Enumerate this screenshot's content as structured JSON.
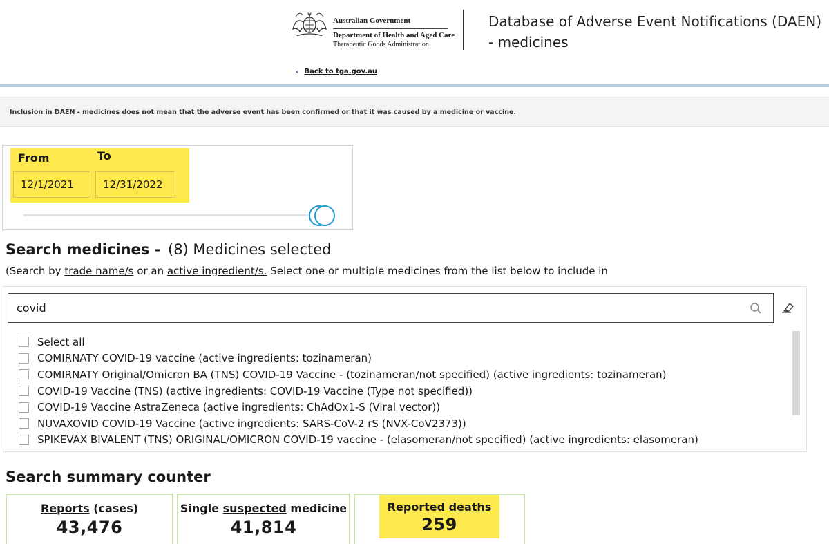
{
  "header": {
    "gov_line1": "Australian Government",
    "gov_line2": "Department of Health and Aged Care",
    "gov_line3": "Therapeutic Goods Administration",
    "db_title": "Database of Adverse Event Notifications (DAEN) - medicines",
    "back_link": "Back to tga.gov.au"
  },
  "notice": "Inclusion in DAEN - medicines does not mean that the adverse event has been confirmed or that it was caused by a medicine or vaccine.",
  "date_range": {
    "from_label": "From",
    "to_label": "To",
    "from_value": "12/1/2021",
    "to_value": "12/31/2022"
  },
  "search": {
    "heading": "Search medicines -",
    "selected": "(8) Medicines selected",
    "desc_prefix": "(Search by ",
    "desc_link1": "trade name/s",
    "desc_mid": " or an ",
    "desc_link2": "active ingredient/s.",
    "desc_suffix": " Select one or multiple medicines from the list below to include in",
    "query": "covid",
    "items": [
      "Select all",
      "COMIRNATY COVID-19 vaccine (active ingredients: tozinameran)",
      "COMIRNATY Original/Omicron BA (TNS) COVID-19 Vaccine - (tozinameran/not specified) (active ingredients: tozinameran)",
      "COVID-19 Vaccine (TNS) (active ingredients: COVID-19 Vaccine (Type not specified))",
      "COVID-19 Vaccine AstraZeneca (active ingredients: ChAdOx1-S (Viral vector))",
      "NUVAXOVID COVID-19 Vaccine (active ingredients: SARS-CoV-2 rS (NVX-CoV2373))",
      "SPIKEVAX BIVALENT (TNS) ORIGINAL/OMICRON COVID-19 vaccine - (elasomeran/not specified) (active ingredients: elasomeran)"
    ]
  },
  "summary": {
    "heading": "Search summary counter",
    "reports_link": "Reports",
    "reports_suffix": " (cases)",
    "reports_value": "43,476",
    "single_prefix": "Single ",
    "single_link": "suspected",
    "single_suffix": " medicine",
    "single_value": "41,814",
    "deaths_prefix": "Reported ",
    "deaths_link": "deaths",
    "deaths_value": "259"
  },
  "colors": {
    "highlight": "#fde94d",
    "slider_handle": "#1e9ad6",
    "card_border": "#c9e0b3",
    "header_bar": "#b8cde4"
  },
  "icons": [
    "coat-of-arms-icon",
    "chevron-left-icon",
    "search-icon",
    "eraser-icon"
  ]
}
